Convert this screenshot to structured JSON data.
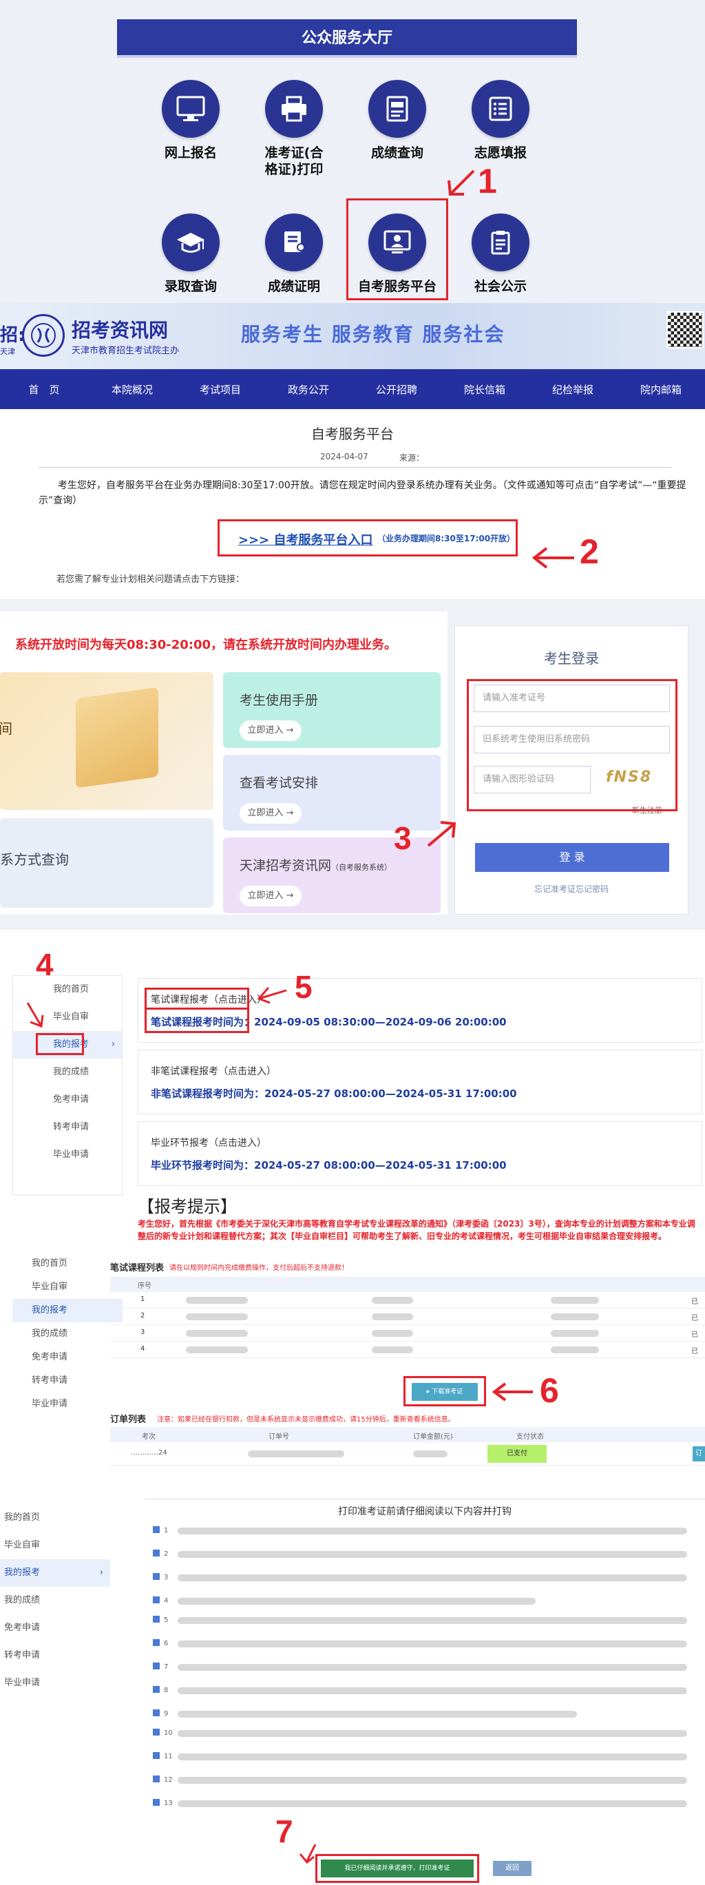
{
  "hall": {
    "title": "公众服务大厅",
    "items": [
      "网上报名",
      "准考证(合格证)打印",
      "成绩查询",
      "志愿填报",
      "录取查询",
      "成绩证明",
      "自考服务平台",
      "社会公示"
    ],
    "item_lines": [
      [
        "网上报名"
      ],
      [
        "准考证(合",
        "格证)打印"
      ],
      [
        "成绩查询"
      ],
      [
        "志愿填报"
      ],
      [
        "录取查询"
      ],
      [
        "成绩证明"
      ],
      [
        "自考服务平台"
      ],
      [
        "社会公示"
      ]
    ]
  },
  "steps": [
    "1",
    "2",
    "3",
    "4",
    "5",
    "6",
    "7"
  ],
  "site": {
    "logo_name": "招考资讯网",
    "logo_sub": "天津市教育招生考试院主办",
    "slogan": "服务考生  服务教育  服务社会",
    "left_cut": "招:",
    "left_cut2": "天津",
    "nav": [
      "首　页",
      "本院概况",
      "考试项目",
      "政务公开",
      "公开招聘",
      "院长信箱",
      "纪检举报",
      "院内邮箱"
    ]
  },
  "article": {
    "title": "自考服务平台",
    "date": "2024-04-07",
    "source_label": "来源：",
    "notice": "考生您好，自考服务平台在业务办理期间8:30至17:00开放。请您在规定时间内登录系统办理有关业务。（文件或通知等可点击“自学考试”—“重要提示”查询）",
    "entry_link": ">>> 自考服务平台入口",
    "entry_note": "（业务办理期间8:30至17:00开放）",
    "more": "若您需了解专业计划相关问题请点击下方链接："
  },
  "platform": {
    "notice": "系统开放时间为每天08:30-20:00，请在系统开放时间内办理业务。",
    "left_cut": "间",
    "left_cut2": "系方式查询",
    "tiles": [
      "考生使用手册",
      "查看考试安排",
      "天津招考资讯网"
    ],
    "tile_note": "（自考服务系统）",
    "enter": "立即进入 →",
    "login_title": "考生登录",
    "ph_id": "请输入准考证号",
    "ph_pwd": "旧系统考生使用旧系统密码",
    "ph_code": "请输入图形验证码",
    "captcha": "fNS8",
    "new_reg": "新生注册",
    "login_btn": "登 录",
    "forgot": "忘记准考证忘记密码"
  },
  "menu": [
    "我的首页",
    "毕业自审",
    "我的报考",
    "我的成绩",
    "免考申请",
    "转考申请",
    "毕业申请"
  ],
  "menu_short": [
    "我的首页",
    "毕业自审",
    "我的报考",
    "我的成绩",
    "免考申请",
    "转考申请",
    "毕业申请"
  ],
  "enroll_cards": [
    {
      "title": "笔试课程报考（点击进入）",
      "time": "笔试课程报考时间为：2024-09-05 08:30:00—2024-09-06 20:00:00"
    },
    {
      "title": "非笔试课程报考（点击进入）",
      "time": "非笔试课程报考时间为：2024-05-27 08:00:00—2024-05-31 17:00:00"
    },
    {
      "title": "毕业环节报考（点击进入）",
      "time": "毕业环节报考时间为：2024-05-27 08:00:00—2024-05-31 17:00:00"
    }
  ],
  "tips": {
    "title": "【报考提示】",
    "text": "考生您好，首先根据《市考委关于深化天津市高等教育自学考试专业课程改革的通知》（津考委函〔2023〕3号），查询本专业的计划调整方案和本专业调整后的新专业计划和课程替代方案；其次【毕业自审栏目】可帮助考生了解新、旧专业的考试课程情况，考生可根据毕业自审结果合理安排报考。"
  },
  "course_table": {
    "title": "笔试课程列表",
    "warn": "请在以规则时间内完成缴费操作，支付后超后不支持退款！",
    "rows": [
      "1",
      "2",
      "3",
      "4"
    ],
    "status": "已",
    "cols": [
      "序号"
    ],
    "pay_btn": "▸ 下载准考证"
  },
  "order_table": {
    "title": "订单列表",
    "warn": "注意：如果已经在银行扣款，但是未系统显示未显示缴费成功，请15分钟后，重新查看系统信息。",
    "cols": [
      "考次",
      "订单号",
      "订单金额(元)",
      "支付状态"
    ],
    "row_id": "…………24",
    "status": "已支付",
    "view": "订"
  },
  "print": {
    "title": "打印准考证前请仔细阅读以下内容并打钩",
    "items": [
      "1",
      "2",
      "3",
      "4",
      "5",
      "6",
      "7",
      "8",
      "9",
      "10",
      "11",
      "12",
      "13"
    ],
    "confirm_btn": "我已仔细阅读并承诺遵守，打印准考证",
    "back_btn": "返回"
  },
  "colors": {
    "accent": "#2a3593",
    "red": "#e5232b",
    "nav": "#2530a0"
  }
}
